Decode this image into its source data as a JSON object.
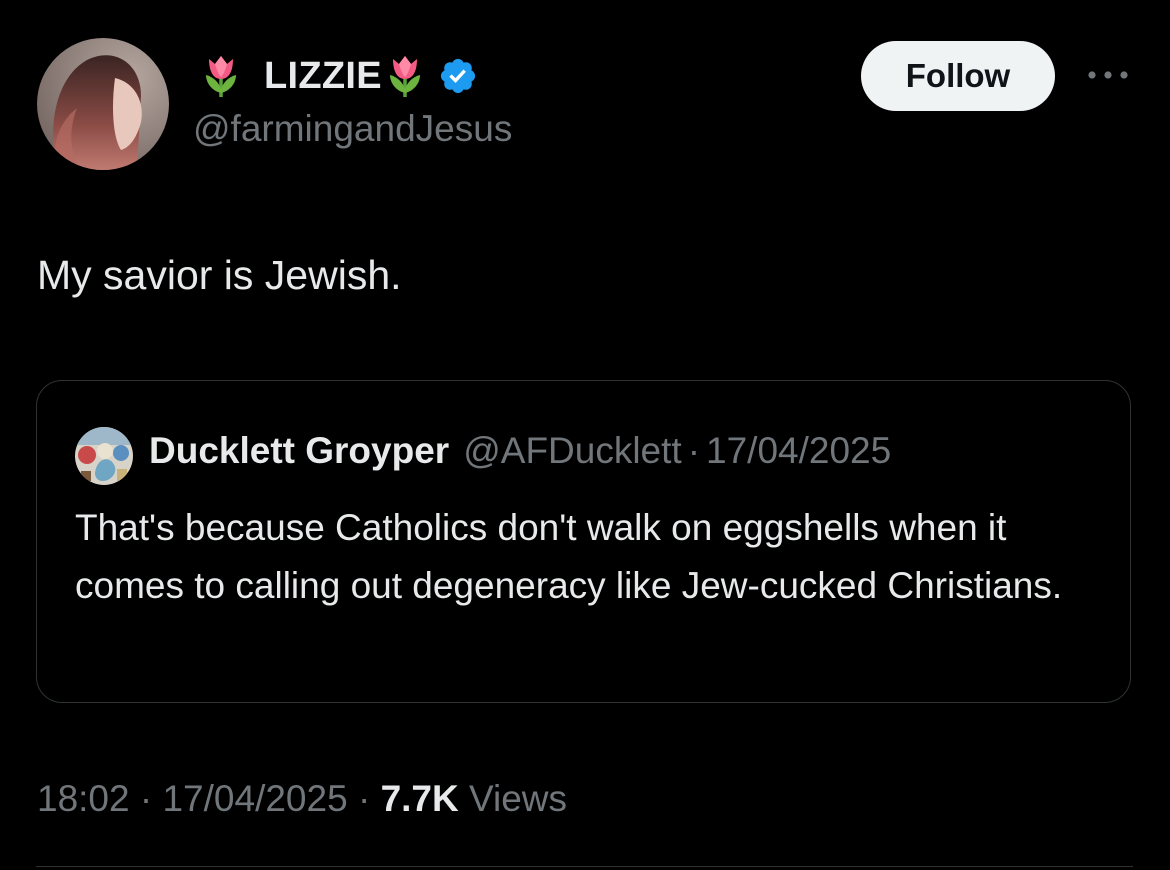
{
  "author": {
    "display_name": "LIZZIE",
    "handle": "@farmingandJesus",
    "verified": true,
    "name_emoji": "tulip-icon",
    "verified_color": "#1d9bf0"
  },
  "follow_label": "Follow",
  "tweet": {
    "text": "My savior is Jewish."
  },
  "quoted_tweet": {
    "author_name": "Ducklett Groyper",
    "handle": "@AFDucklett",
    "separator": "·",
    "date": "17/04/2025",
    "text": "That's because Catholics don't walk on eggshells when it comes to calling out degeneracy like Jew-cucked Christians."
  },
  "meta": {
    "time": "18:02",
    "sep1": " · ",
    "date": "17/04/2025",
    "sep2": " · ",
    "views_count": "7.7K",
    "views_label": " Views"
  },
  "colors": {
    "background": "#000000",
    "text_primary": "#e7e9ea",
    "text_secondary": "#71767b",
    "border": "#2f3336",
    "follow_bg": "#eff3f4"
  }
}
